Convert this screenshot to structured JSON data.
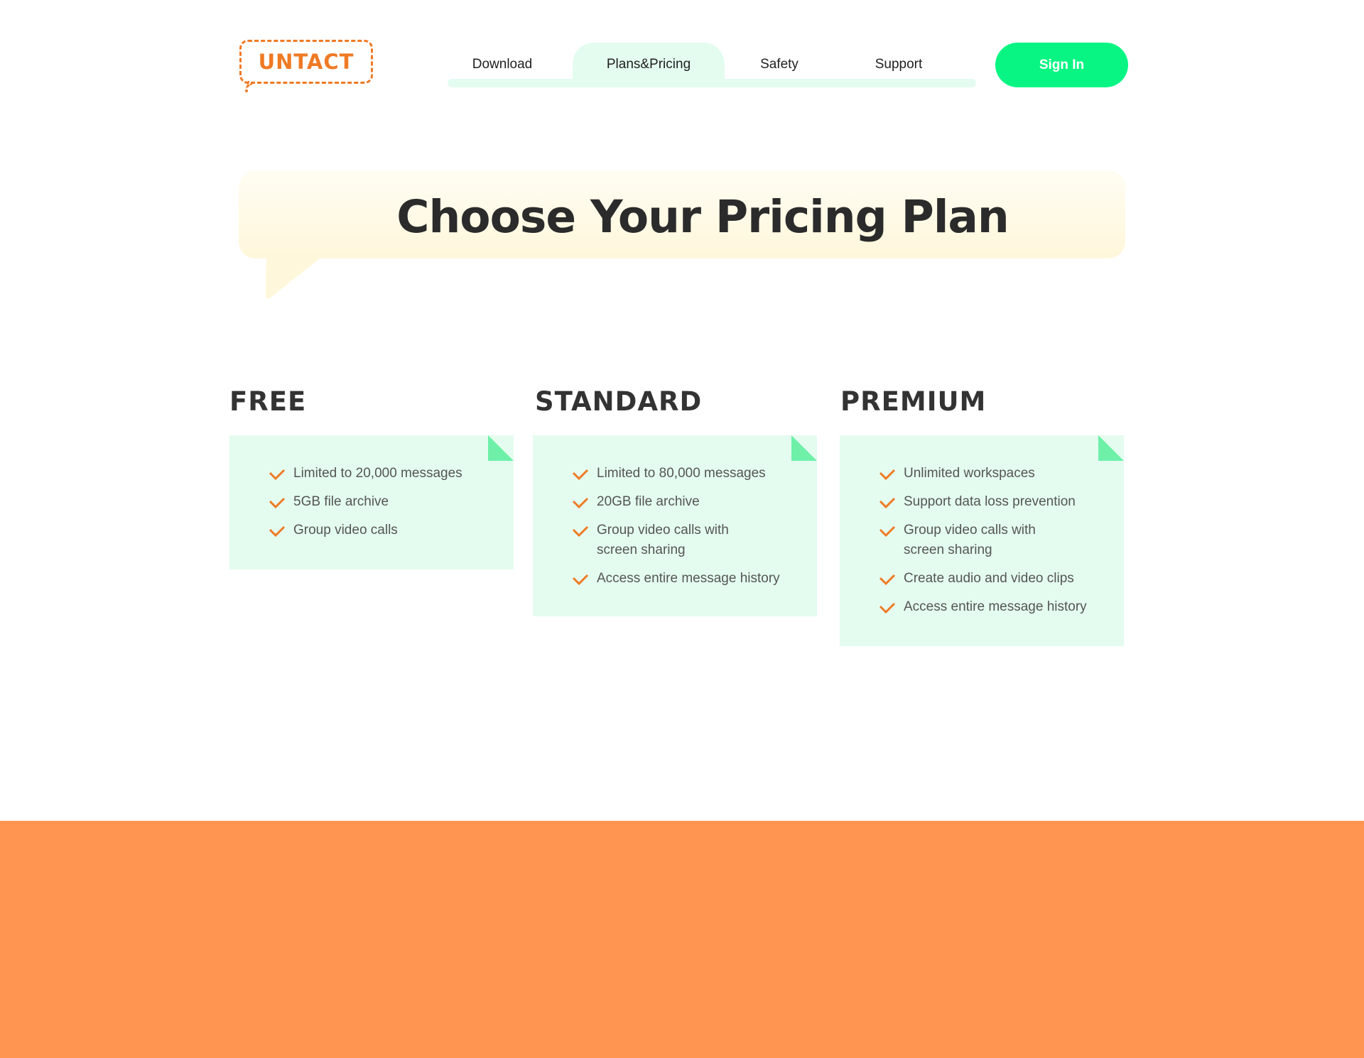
{
  "header": {
    "logo_text": "UNTACT",
    "nav": [
      {
        "label": "Download",
        "active": false
      },
      {
        "label": "Plans&Pricing",
        "active": true
      },
      {
        "label": "Safety",
        "active": false
      },
      {
        "label": "Support",
        "active": false
      }
    ],
    "signin_label": "Sign In"
  },
  "hero": {
    "title": "Choose Your Pricing Plan"
  },
  "plans": [
    {
      "name": "FREE",
      "features": [
        "Limited to 20,000 messages",
        "5GB file archive",
        "Group video calls"
      ]
    },
    {
      "name": "STANDARD",
      "features": [
        "Limited to 80,000 messages",
        "20GB file archive",
        "Group video calls with screen sharing",
        "Access entire message history"
      ]
    },
    {
      "name": "PREMIUM",
      "features": [
        "Unlimited workspaces",
        "Support data loss prevention",
        "Group video calls with screen sharing",
        "Create audio and video clips",
        "Access entire message history"
      ]
    }
  ],
  "icons": {
    "feature": "check-icon",
    "card_corner": "page-fold-icon"
  },
  "colors": {
    "brand_orange": "#ef7a24",
    "accent_green": "#09f583",
    "card_bg": "#e4fcef",
    "corner_green": "#6ef0a9",
    "hero_bg": "#fff7db",
    "footer_orange": "#ff9550"
  }
}
